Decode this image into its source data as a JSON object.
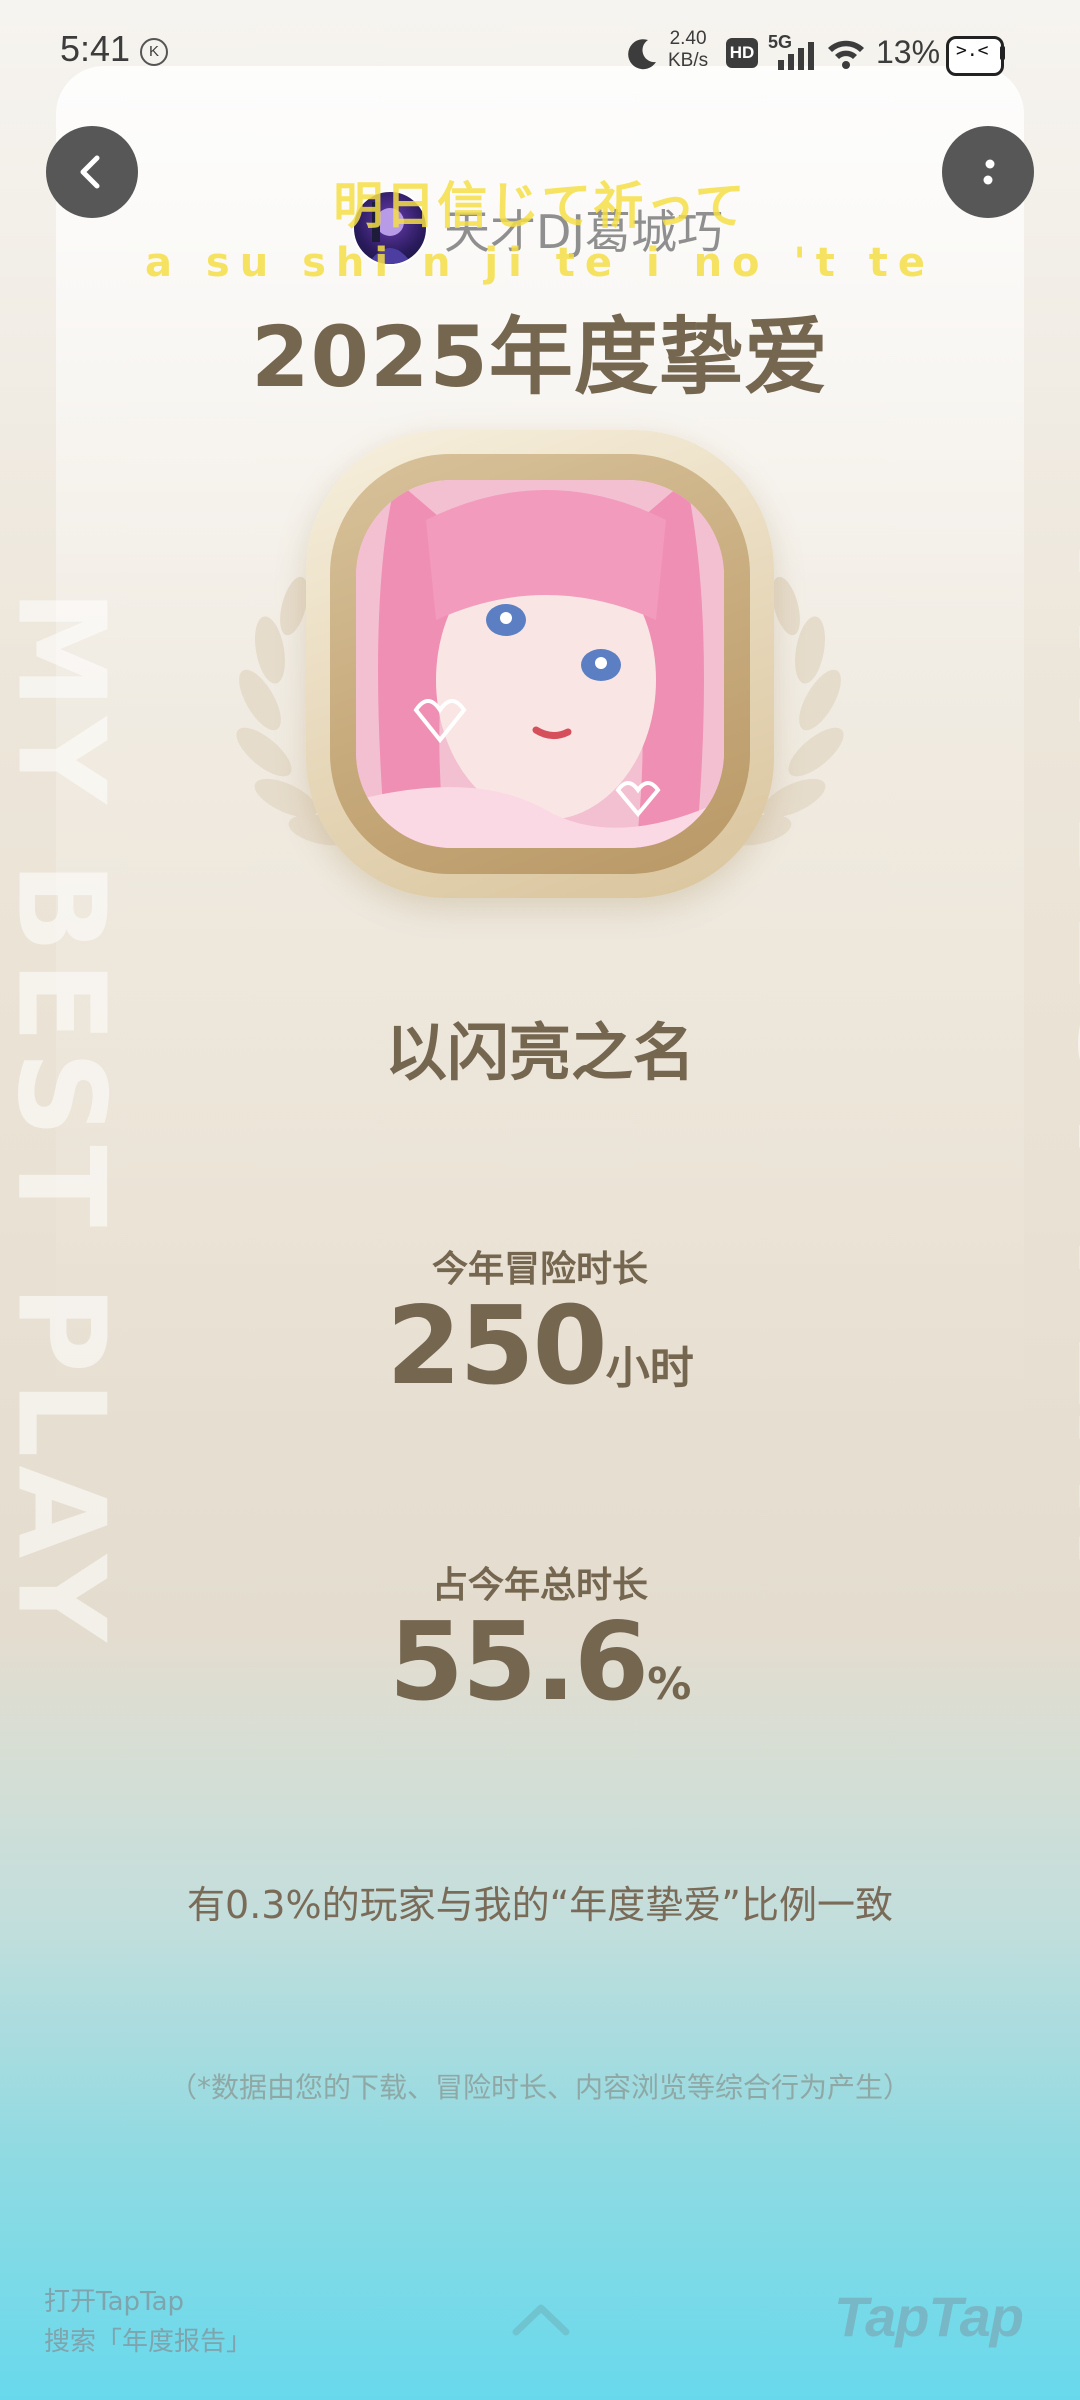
{
  "status_bar": {
    "time": "5:41",
    "k_badge": "K",
    "net_speed_value": "2.40",
    "net_speed_unit": "KB/s",
    "hd_label": "HD",
    "network_label": "5G",
    "battery_percent": "13%"
  },
  "header": {
    "user_name": "天才DJ葛城巧",
    "lyric_line_1": "明日信じて祈って",
    "lyric_line_2": "a su shi n ji te i no 't te",
    "report_title": "2025年度挚爱"
  },
  "game": {
    "name": "以闪亮之名"
  },
  "stats": {
    "playtime_label": "今年冒险时长",
    "playtime_value": "250",
    "playtime_unit": "小时",
    "share_label": "占今年总时长",
    "share_value": "55.6",
    "share_unit": "%"
  },
  "compare_text": "有0.3%的玩家与我的“年度挚爱”比例一致",
  "footnote": "（*数据由您的下载、冒险时长、内容浏览等综合行为产生）",
  "footer": {
    "open_app_line": "打开TapTap",
    "search_line": "搜索「年度报告」",
    "logo_text": "TapTap"
  },
  "colors": {
    "title_brown": "#756650",
    "lyric_yellow": "#f5de46",
    "bottom_cyan": "#68d9ec",
    "button_gray": "#575757"
  },
  "icons": {
    "back": "chevron-left-icon",
    "more": "vertical-dots-icon",
    "swipe_up": "chevron-up-icon"
  }
}
